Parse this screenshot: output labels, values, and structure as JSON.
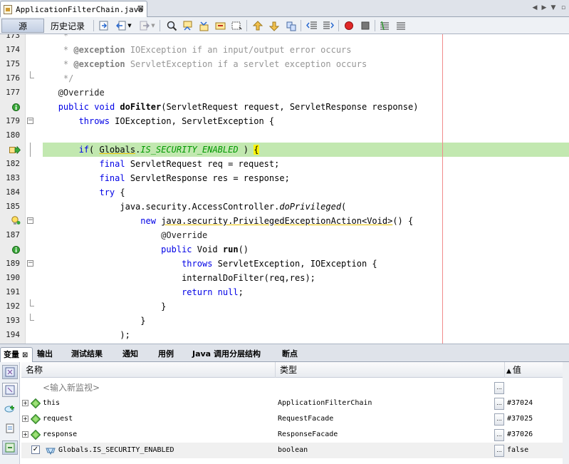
{
  "editor_tab": {
    "filename": "ApplicationFilterChain.java"
  },
  "toolbar": {
    "source_label": "源",
    "history_label": "历史记录"
  },
  "code_lines": [
    {
      "n": "173",
      "gutter_icon": "",
      "fold": "",
      "highlight": false,
      "tokens": [
        [
          "    ",
          ""
        ],
        [
          "*",
          "cm"
        ]
      ]
    },
    {
      "n": "174",
      "gutter_icon": "",
      "fold": "",
      "highlight": false,
      "tokens": [
        [
          "    * ",
          "cm"
        ],
        [
          "@exception",
          "ck"
        ],
        [
          " IOException if an input/output error occurs",
          "cm"
        ]
      ]
    },
    {
      "n": "175",
      "gutter_icon": "",
      "fold": "",
      "highlight": false,
      "tokens": [
        [
          "    * ",
          "cm"
        ],
        [
          "@exception",
          "ck"
        ],
        [
          " ServletException if a servlet exception occurs",
          "cm"
        ]
      ]
    },
    {
      "n": "176",
      "gutter_icon": "",
      "fold": "end",
      "highlight": false,
      "tokens": [
        [
          "    */",
          "cm"
        ]
      ]
    },
    {
      "n": "177",
      "gutter_icon": "",
      "fold": "",
      "highlight": false,
      "tokens": [
        [
          "   @Override",
          "ann"
        ]
      ]
    },
    {
      "n": "",
      "gutter_icon": "implements",
      "fold": "",
      "highlight": false,
      "tokens": [
        [
          "   ",
          ""
        ],
        [
          "public",
          "kw"
        ],
        [
          " ",
          ""
        ],
        [
          "void",
          "kw"
        ],
        [
          " ",
          ""
        ],
        [
          "doFilter",
          "bold"
        ],
        [
          "(ServletRequest request, ServletResponse response)",
          ""
        ]
      ]
    },
    {
      "n": "179",
      "gutter_icon": "",
      "fold": "minus",
      "highlight": false,
      "tokens": [
        [
          "       ",
          ""
        ],
        [
          "throws",
          "kw"
        ],
        [
          " IOException, ServletException {",
          ""
        ]
      ]
    },
    {
      "n": "180",
      "gutter_icon": "",
      "fold": "",
      "highlight": false,
      "tokens": [
        [
          "",
          ""
        ]
      ]
    },
    {
      "n": "",
      "gutter_icon": "current",
      "fold": "line",
      "highlight": true,
      "tokens": [
        [
          "       ",
          ""
        ],
        [
          "if",
          "kw"
        ],
        [
          "( ",
          ""
        ],
        [
          "Globals",
          "sq"
        ],
        [
          ".",
          ""
        ],
        [
          "IS_SECURITY_ENABLED",
          "fld"
        ],
        [
          " ) ",
          ""
        ],
        [
          "{",
          "brk"
        ]
      ]
    },
    {
      "n": "182",
      "gutter_icon": "",
      "fold": "",
      "highlight": false,
      "tokens": [
        [
          "           ",
          ""
        ],
        [
          "final",
          "kw"
        ],
        [
          " ServletRequest req = request;",
          ""
        ]
      ]
    },
    {
      "n": "183",
      "gutter_icon": "",
      "fold": "",
      "highlight": false,
      "tokens": [
        [
          "           ",
          ""
        ],
        [
          "final",
          "kw"
        ],
        [
          " ServletResponse res = response;",
          ""
        ]
      ]
    },
    {
      "n": "184",
      "gutter_icon": "",
      "fold": "",
      "highlight": false,
      "tokens": [
        [
          "           ",
          ""
        ],
        [
          "try",
          "kw"
        ],
        [
          " {",
          ""
        ]
      ]
    },
    {
      "n": "185",
      "gutter_icon": "",
      "fold": "",
      "highlight": false,
      "tokens": [
        [
          "               java.security.AccessController.",
          ""
        ],
        [
          "doPrivileged",
          "it"
        ],
        [
          "(",
          ""
        ]
      ]
    },
    {
      "n": "",
      "gutter_icon": "hint",
      "fold": "minus",
      "highlight": false,
      "tokens": [
        [
          "                   ",
          ""
        ],
        [
          "new",
          "kw"
        ],
        [
          " ",
          ""
        ],
        [
          "java.security.PrivilegedExceptionAction<Void>",
          "sq"
        ],
        [
          "() {",
          ""
        ]
      ]
    },
    {
      "n": "187",
      "gutter_icon": "",
      "fold": "",
      "highlight": false,
      "tokens": [
        [
          "                       @Override",
          "ann"
        ]
      ]
    },
    {
      "n": "",
      "gutter_icon": "implements",
      "fold": "",
      "highlight": false,
      "tokens": [
        [
          "                       ",
          ""
        ],
        [
          "public",
          "kw"
        ],
        [
          " Void ",
          ""
        ],
        [
          "run",
          "bold"
        ],
        [
          "()",
          ""
        ]
      ]
    },
    {
      "n": "189",
      "gutter_icon": "",
      "fold": "minus",
      "highlight": false,
      "tokens": [
        [
          "                           ",
          ""
        ],
        [
          "throws",
          "kw"
        ],
        [
          " ServletException, IOException {",
          ""
        ]
      ]
    },
    {
      "n": "190",
      "gutter_icon": "",
      "fold": "",
      "highlight": false,
      "tokens": [
        [
          "                           internalDoFilter(req,res);",
          ""
        ]
      ]
    },
    {
      "n": "191",
      "gutter_icon": "",
      "fold": "",
      "highlight": false,
      "tokens": [
        [
          "                           ",
          ""
        ],
        [
          "return",
          "kw"
        ],
        [
          " ",
          ""
        ],
        [
          "null",
          "kw"
        ],
        [
          ";",
          ""
        ]
      ]
    },
    {
      "n": "192",
      "gutter_icon": "",
      "fold": "end",
      "highlight": false,
      "tokens": [
        [
          "                       }",
          ""
        ]
      ]
    },
    {
      "n": "193",
      "gutter_icon": "",
      "fold": "end",
      "highlight": false,
      "tokens": [
        [
          "                   }",
          ""
        ]
      ]
    },
    {
      "n": "194",
      "gutter_icon": "",
      "fold": "",
      "highlight": false,
      "tokens": [
        [
          "               );",
          ""
        ]
      ]
    }
  ],
  "bottom_tabs": [
    "变量",
    "输出",
    "测试结果",
    "通知",
    "用例",
    "Java 调用分层结构",
    "断点"
  ],
  "bottom_tab_close": "⊠",
  "variables": {
    "columns": {
      "name": "名称",
      "type": "类型",
      "value": "值"
    },
    "sort_arrow": "▲",
    "watch_placeholder": "<输入新监视>",
    "rows": [
      {
        "expand": "+",
        "icon": "green-diamond-icon",
        "name": "this",
        "type": "ApplicationFilterChain",
        "value": "#37024",
        "checkbox": false
      },
      {
        "expand": "+",
        "icon": "green-diamond-icon",
        "name": "request",
        "type": "RequestFacade",
        "value": "#37025",
        "checkbox": false
      },
      {
        "expand": "+",
        "icon": "green-diamond-icon",
        "name": "response",
        "type": "ResponseFacade",
        "value": "#37026",
        "checkbox": false
      },
      {
        "expand": "",
        "icon": "watch-glasses-icon",
        "name": "Globals.IS_SECURITY_ENABLED",
        "type": "boolean",
        "value": "false",
        "checkbox": true
      }
    ]
  },
  "colors": {
    "current_line": "#c2e8b0",
    "keyword": "#0000e6",
    "comment": "#969696",
    "field": "#009900",
    "right_margin": "#f08a8a"
  }
}
